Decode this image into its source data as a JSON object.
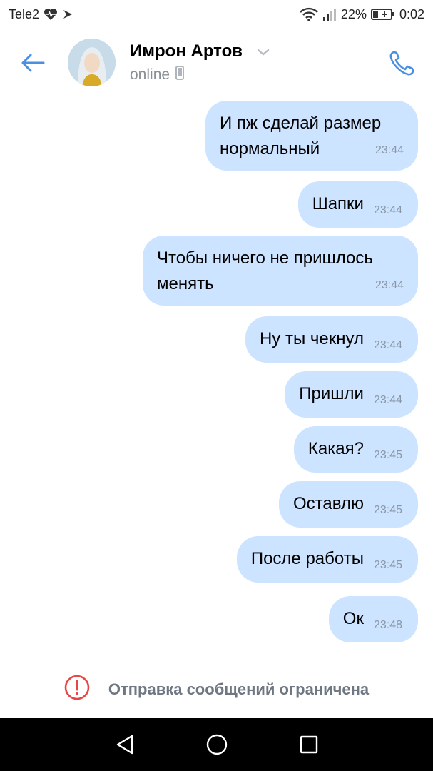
{
  "status_bar": {
    "carrier": "Tele2",
    "battery": "22%",
    "time": "0:02",
    "icons": [
      "heart-pulse-icon",
      "notification-icon",
      "wifi-icon",
      "signal-icon",
      "battery-icon"
    ]
  },
  "header": {
    "name": "Имрон Артов",
    "status": "online",
    "icons": [
      "back-arrow-icon",
      "chevron-down-icon",
      "phone-icon",
      "mobile-device-icon"
    ],
    "accent_color": "#4a8fe0"
  },
  "messages": [
    {
      "text": "И пж сделай размер нормальный",
      "time": "23:44"
    },
    {
      "text": "Шапки",
      "time": "23:44"
    },
    {
      "text": "Чтобы ничего не пришлось менять",
      "time": "23:44"
    },
    {
      "text": "Ну ты чекнул",
      "time": "23:44"
    },
    {
      "text": "Пришли",
      "time": "23:44"
    },
    {
      "text": "Какая?",
      "time": "23:45"
    },
    {
      "text": "Оставлю",
      "time": "23:45"
    },
    {
      "text": "После работы",
      "time": "23:45"
    },
    {
      "text": "Ок",
      "time": "23:48"
    }
  ],
  "bubble_color": "#cce4ff",
  "restricted": {
    "text": "Отправка сообщений ограничена",
    "icon": "warning-circle-icon",
    "icon_color": "#e64646"
  },
  "nav": {
    "icons": [
      "back-triangle-icon",
      "home-circle-icon",
      "recents-square-icon"
    ]
  }
}
